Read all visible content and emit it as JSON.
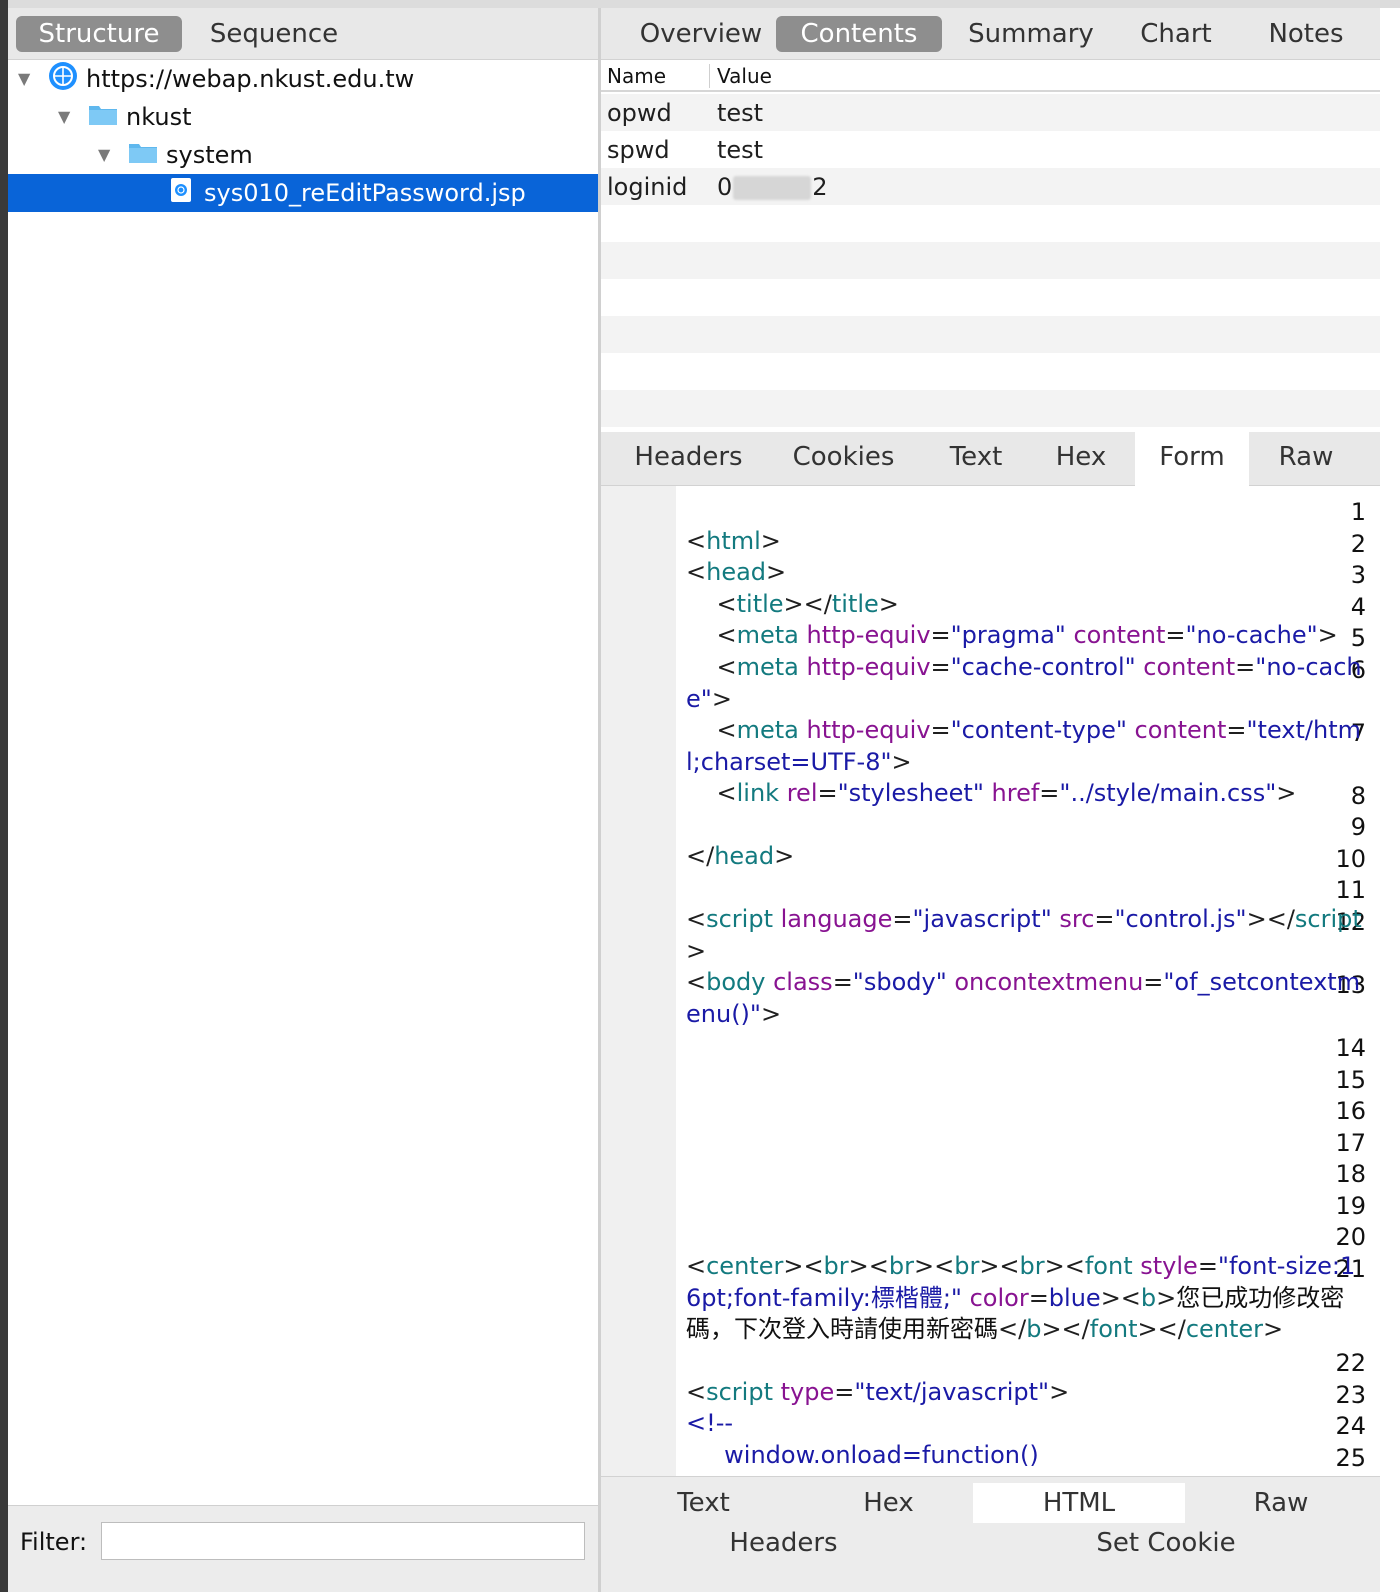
{
  "left_tabs": [
    "Structure",
    "Sequence"
  ],
  "tree": [
    {
      "label": "https://webap.nkust.edu.tw",
      "icon": "globe-icon"
    },
    {
      "label": "nkust",
      "icon": "folder-icon"
    },
    {
      "label": "system",
      "icon": "folder-icon"
    },
    {
      "label": "sys010_reEditPassword.jsp",
      "icon": "file-icon",
      "selected": true
    }
  ],
  "filter": {
    "label": "Filter:",
    "value": ""
  },
  "right_tabs": [
    "Overview",
    "Contents",
    "Summary",
    "Chart",
    "Notes"
  ],
  "table": {
    "headers": [
      "Name",
      "Value"
    ],
    "rows": [
      {
        "name": "opwd",
        "value": "test"
      },
      {
        "name": "spwd",
        "value": "test"
      },
      {
        "name": "loginid",
        "value_prefix": "0",
        "value_suffix": "2"
      }
    ]
  },
  "sub_tabs": [
    "Headers",
    "Cookies",
    "Text",
    "Hex",
    "Form",
    "Raw"
  ],
  "code": {
    "line_numbers": [
      "1",
      "2",
      "3",
      "4",
      "5",
      "6",
      "7",
      "8",
      "9",
      "10",
      "11",
      "12",
      "13",
      "14",
      "15",
      "16",
      "17",
      "18",
      "19",
      "20",
      "21",
      "22",
      "23",
      "24",
      "25"
    ],
    "l2": [
      "<",
      "html",
      ">"
    ],
    "l3": [
      "<",
      "head",
      ">"
    ],
    "l4": [
      "    <",
      "title",
      "></",
      "title",
      ">"
    ],
    "l5": [
      "    <",
      "meta",
      " http-equiv",
      "=",
      "\"pragma\"",
      " content",
      "=",
      "\"no-cache\"",
      ">"
    ],
    "l6": [
      "    <",
      "meta",
      " http-equiv",
      "=",
      "\"cache-control\"",
      " content",
      "=",
      "\"no-cache\"",
      ">"
    ],
    "l7": [
      "    <",
      "meta",
      " http-equiv",
      "=",
      "\"content-type\"",
      " content",
      "=",
      "\"text/html;charset=UTF-8\"",
      ">"
    ],
    "l8": [
      "    <",
      "link",
      " rel",
      "=",
      "\"stylesheet\"",
      " href",
      "=",
      "\"../style/main.css\"",
      ">"
    ],
    "l10": [
      "</",
      "head",
      ">"
    ],
    "l12": [
      "<",
      "script",
      " language",
      "=",
      "\"javascript\"",
      " src",
      "=",
      "\"control.js\"",
      "></",
      "script",
      ">"
    ],
    "l13": [
      "<",
      "body",
      " class",
      "=",
      "\"sbody\"",
      " oncontextmenu",
      "=",
      "\"of_setcontextmenu()\"",
      ">"
    ],
    "l21": [
      "<",
      "center",
      "><",
      "br",
      "><",
      "br",
      "><",
      "br",
      "><",
      "br",
      "><",
      "font",
      " style",
      "=",
      "\"font-size:16pt;font-family:標楷體;\"",
      " color",
      "=",
      "blue",
      "><",
      "b",
      ">",
      "您已成功修改密碼，下次登入時請使用新密碼",
      "</",
      "b",
      "></",
      "font",
      "></",
      "center",
      ">"
    ],
    "l23": [
      "<",
      "script",
      " type",
      "=",
      "\"text/javascript\"",
      ">"
    ],
    "l24": "<!--",
    "l25": "     window.onload=function()"
  },
  "bottom_tabs_row1": [
    "Text",
    "Hex",
    "HTML",
    "Raw"
  ],
  "bottom_tabs_row2": [
    "Headers",
    "Set Cookie"
  ],
  "colors": {
    "selection": "#0964d8",
    "tag": "#137a7f",
    "attr": "#881391",
    "string": "#1a1aa6"
  }
}
